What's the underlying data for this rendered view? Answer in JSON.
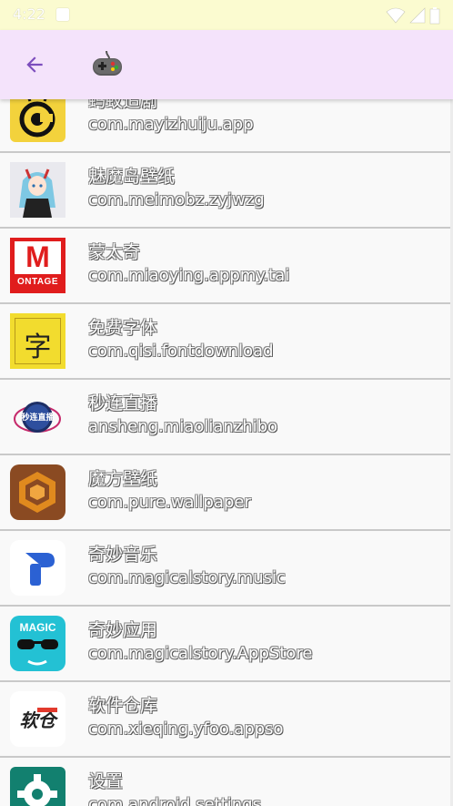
{
  "status_bar": {
    "time": "4:22"
  },
  "app_bar": {
    "back_icon": "arrow-left-icon",
    "title_icon": "gamepad-icon",
    "accent": "#7c4dbd",
    "background": "#f4e3fb"
  },
  "apps": [
    {
      "name": "蚂蚁追剧",
      "package": "com.mayizhuiju.app",
      "icon": "ant-drama-icon"
    },
    {
      "name": "魅魔岛壁纸",
      "package": "com.meimobz.zyjwzg",
      "icon": "anime-girl-icon"
    },
    {
      "name": "蒙太奇",
      "package": "com.miaoying.appmy.tai",
      "icon": "montage-icon",
      "icon_text": "ONTAGE",
      "icon_letter": "M"
    },
    {
      "name": "免费字体",
      "package": "com.qisi.fontdownload",
      "icon": "font-char-icon",
      "icon_text": "字"
    },
    {
      "name": "秒连直播",
      "package": "ansheng.miaolianzhibo",
      "icon": "live-stream-icon",
      "icon_text": "秒连直播"
    },
    {
      "name": "魔方壁纸",
      "package": "com.pure.wallpaper",
      "icon": "cube-icon"
    },
    {
      "name": "奇妙音乐",
      "package": "com.magicalstory.music",
      "icon": "music-p-icon"
    },
    {
      "name": "奇妙应用",
      "package": "com.magicalstory.AppStore",
      "icon": "magic-sunglasses-icon",
      "icon_text": "MAGIC"
    },
    {
      "name": "软件仓库",
      "package": "com.xieqing.yfoo.appso",
      "icon": "software-repo-icon",
      "icon_text": "软仓"
    },
    {
      "name": "设置",
      "package": "com.android.settings",
      "icon": "settings-gear-icon"
    }
  ]
}
